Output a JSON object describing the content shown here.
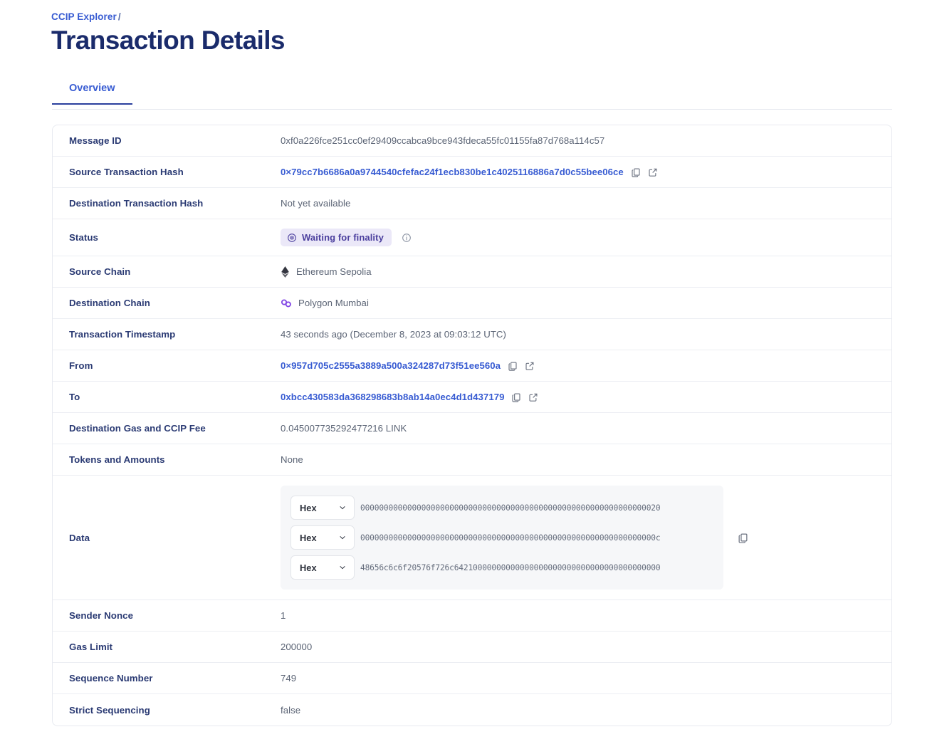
{
  "breadcrumb": {
    "root": "CCIP Explorer",
    "separator": "/"
  },
  "page_title": "Transaction Details",
  "tabs": [
    {
      "label": "Overview",
      "active": true
    }
  ],
  "rows": {
    "message_id": {
      "label": "Message ID",
      "value": "0xf0a226fce251cc0ef29409ccabca9bce943fdeca55fc01155fa87d768a114c57"
    },
    "source_tx_hash": {
      "label": "Source Transaction Hash",
      "value": "0×79cc7b6686a0a9744540cfefac24f1ecb830be1c4025116886a7d0c55bee06ce"
    },
    "destination_tx_hash": {
      "label": "Destination Transaction Hash",
      "value": "Not yet available"
    },
    "status": {
      "label": "Status",
      "badge": "Waiting for finality"
    },
    "source_chain": {
      "label": "Source Chain",
      "value": "Ethereum Sepolia"
    },
    "destination_chain": {
      "label": "Destination Chain",
      "value": "Polygon Mumbai"
    },
    "timestamp": {
      "label": "Transaction Timestamp",
      "value": "43 seconds ago (December 8, 2023 at 09:03:12 UTC)"
    },
    "from": {
      "label": "From",
      "value": "0×957d705c2555a3889a500a324287d73f51ee560a"
    },
    "to": {
      "label": "To",
      "value": "0xbcc430583da368298683b8ab14a0ec4d1d437179"
    },
    "fee": {
      "label": "Destination Gas and CCIP Fee",
      "value": "0.045007735292477216 LINK"
    },
    "tokens": {
      "label": "Tokens and Amounts",
      "value": "None"
    },
    "data": {
      "label": "Data",
      "lines": [
        {
          "format": "Hex",
          "value": "0000000000000000000000000000000000000000000000000000000000000020"
        },
        {
          "format": "Hex",
          "value": "000000000000000000000000000000000000000000000000000000000000000c"
        },
        {
          "format": "Hex",
          "value": "48656c6c6f20576f726c64210000000000000000000000000000000000000000"
        }
      ]
    },
    "sender_nonce": {
      "label": "Sender Nonce",
      "value": "1"
    },
    "gas_limit": {
      "label": "Gas Limit",
      "value": "200000"
    },
    "sequence_number": {
      "label": "Sequence Number",
      "value": "749"
    },
    "strict_sequencing": {
      "label": "Strict Sequencing",
      "value": "false"
    }
  },
  "colors": {
    "brand_blue": "#375bd2",
    "title_navy": "#1a2b6b",
    "badge_bg": "#ebe8f8",
    "badge_text": "#4b3f9e",
    "polygon_purple": "#8247e5"
  }
}
